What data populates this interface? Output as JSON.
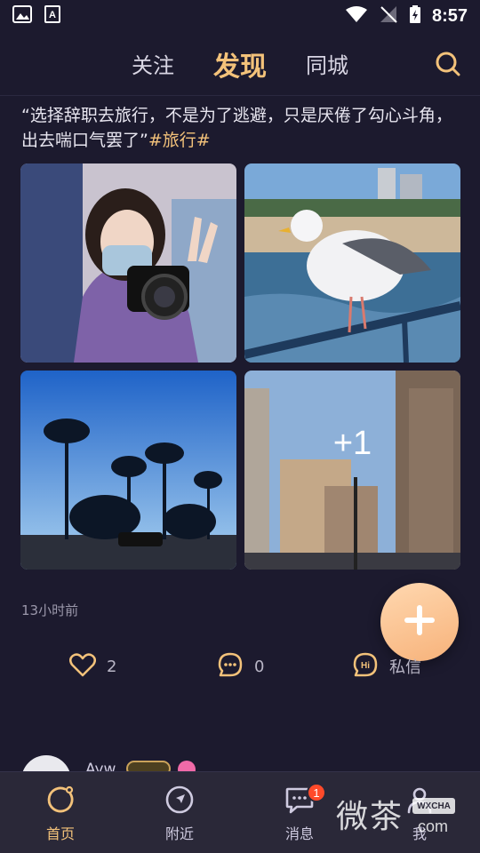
{
  "status": {
    "time": "8:57"
  },
  "tabs": [
    {
      "label": "关注",
      "active": false
    },
    {
      "label": "发现",
      "active": true
    },
    {
      "label": "同城",
      "active": false
    }
  ],
  "post": {
    "text_main": "“选择辞职去旅行，不是为了逃避，只是厌倦了勾心斗角，出去喘口气罢了”",
    "hashtag": "#旅行#",
    "extra_photos": "+1",
    "time_ago": "13小时前",
    "likes": "2",
    "comments": "0",
    "dm_label": "私信"
  },
  "next_post": {
    "name": "Ayw",
    "vip": "VIP"
  },
  "bottom_nav": [
    {
      "label": "首页",
      "icon": "home-icon",
      "active": true
    },
    {
      "label": "附近",
      "icon": "nearby-icon",
      "active": false
    },
    {
      "label": "消息",
      "icon": "message-icon",
      "active": false,
      "badge": "1"
    },
    {
      "label": "我",
      "icon": "profile-icon",
      "active": false
    }
  ],
  "watermark": {
    "text": "微茶",
    "badge": "WXCHA",
    "sub": "com"
  },
  "colors": {
    "accent": "#f3c27a",
    "background": "#1c1a2e",
    "badge": "#ff4a2a"
  }
}
